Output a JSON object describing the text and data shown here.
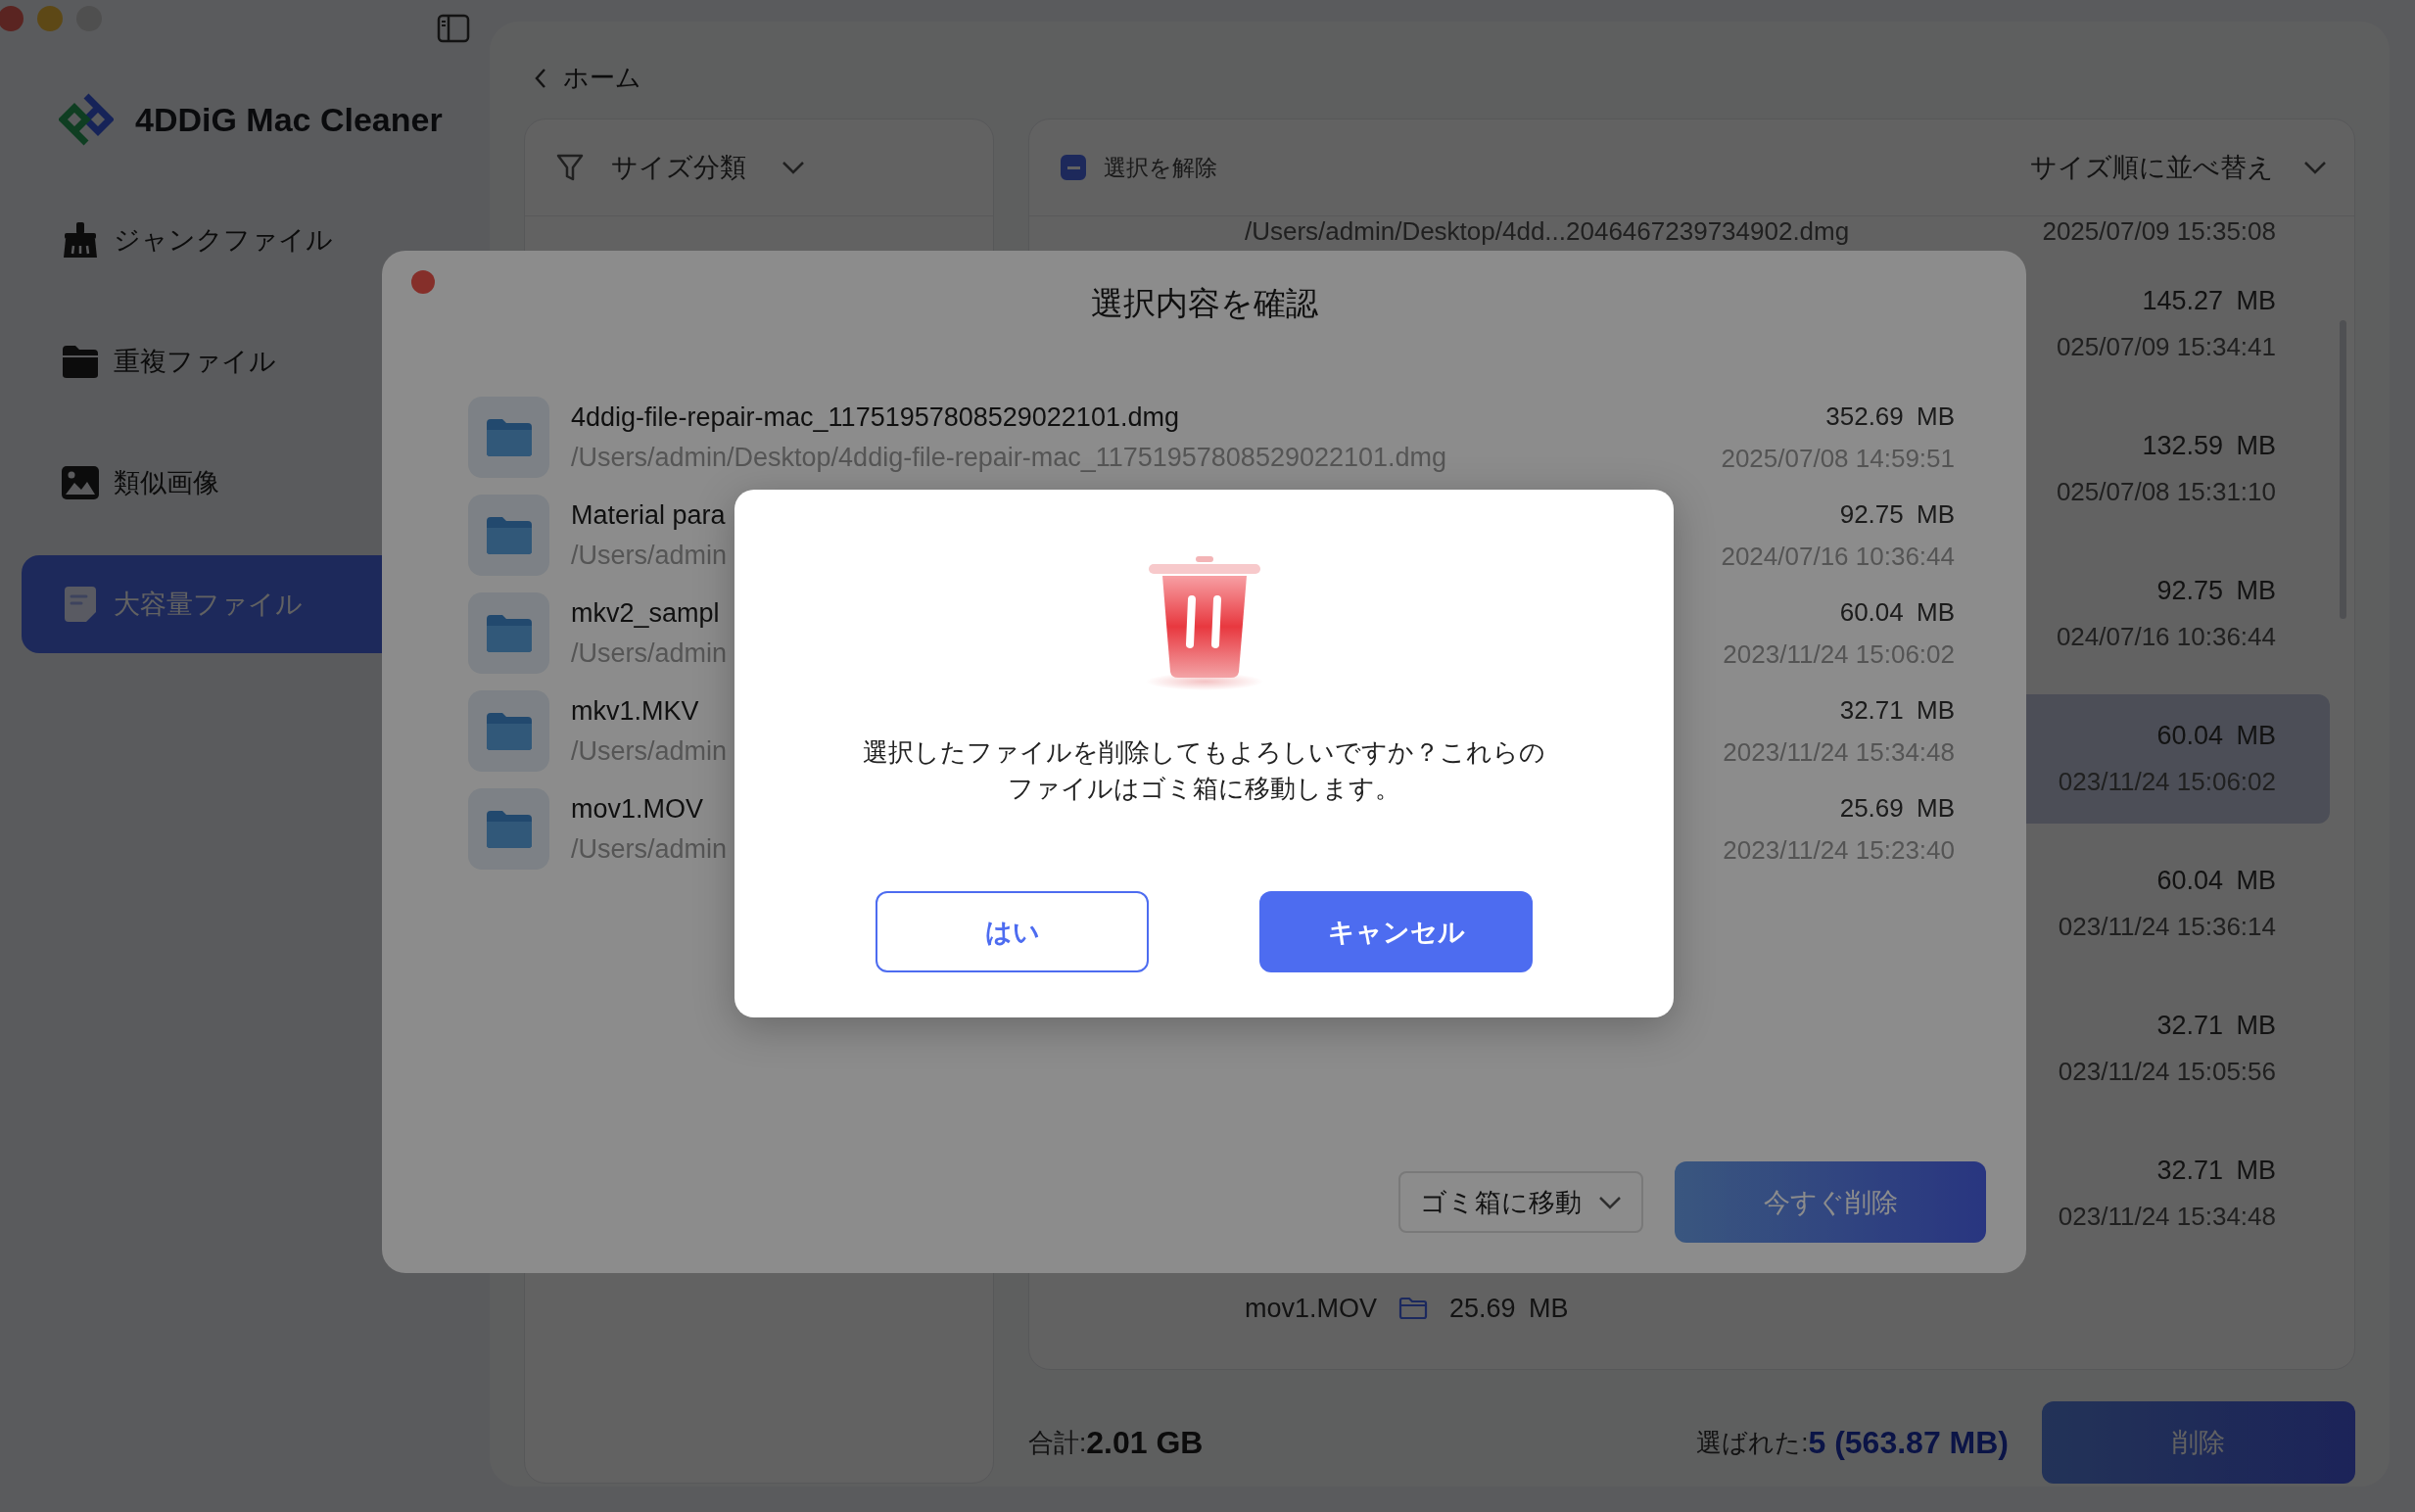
{
  "sidebar": {
    "app_name": "4DDiG Mac Cleaner",
    "items": [
      {
        "label": "ジャンクファイル",
        "kind": "junk",
        "selected": false
      },
      {
        "label": "重複ファイル",
        "kind": "duplicate",
        "selected": false
      },
      {
        "label": "類似画像",
        "kind": "image",
        "selected": false
      },
      {
        "label": "大容量ファイル",
        "kind": "large",
        "selected": true
      }
    ]
  },
  "back_link": "ホーム",
  "filter": {
    "label": "サイズ分類"
  },
  "list": {
    "indeterminate": true,
    "select_label": "選択を解除",
    "sort_label": "サイズ順に並べ替え",
    "rows": [
      {
        "kind": "path",
        "path": "/Users/admin/Desktop/4dd...2046467239734902.dmg",
        "date": "2025/07/09 15:35:08",
        "highlighted": false
      },
      {
        "kind": "stats",
        "size": "145.27 MB",
        "date": "025/07/09 15:34:41",
        "highlighted": false
      },
      {
        "kind": "stats",
        "size": "132.59 MB",
        "date": "025/07/08 15:31:10",
        "highlighted": false
      },
      {
        "kind": "stats",
        "size": "92.75 MB",
        "date": "024/07/16 10:36:44",
        "highlighted": false
      },
      {
        "kind": "stats",
        "size": "60.04 MB",
        "date": "023/11/24 15:06:02",
        "highlighted": true
      },
      {
        "kind": "stats",
        "size": "60.04 MB",
        "date": "023/11/24 15:36:14",
        "highlighted": false
      },
      {
        "kind": "stats",
        "size": "32.71 MB",
        "date": "023/11/24 15:05:56",
        "highlighted": false
      },
      {
        "kind": "stats",
        "size": "32.71 MB",
        "date": "023/11/24 15:34:48",
        "highlighted": false
      },
      {
        "kind": "name",
        "name": "mov1.MOV",
        "size": "25.69 MB",
        "highlighted": false
      }
    ]
  },
  "footer": {
    "total_label": "合計:",
    "total_value": "2.01 GB",
    "selected_label": "選ばれた:",
    "selected_value": "5 (563.87 MB)",
    "delete_button": "削除"
  },
  "confirm_modal": {
    "title": "選択内容を確認",
    "files": [
      {
        "name": "4ddig-file-repair-mac_11751957808529022101.dmg",
        "path": "/Users/admin/Desktop/4ddig-file-repair-mac_11751957808529022101.dmg",
        "size": "352.69 MB",
        "date": "2025/07/08 14:59:51"
      },
      {
        "name": "Material para",
        "path": "/Users/admin",
        "size": "92.75 MB",
        "date": "2024/07/16 10:36:44"
      },
      {
        "name": "mkv2_sampl",
        "path": "/Users/admin",
        "size": "60.04 MB",
        "date": "2023/11/24 15:06:02"
      },
      {
        "name": "mkv1.MKV",
        "path": "/Users/admin",
        "size": "32.71 MB",
        "date": "2023/11/24 15:34:48"
      },
      {
        "name": "mov1.MOV",
        "path": "/Users/admin",
        "size": "25.69 MB",
        "date": "2023/11/24 15:23:40"
      }
    ],
    "action_select": "ゴミ箱に移動",
    "delete_now_button": "今すぐ削除"
  },
  "alert": {
    "message": "選択したファイルを削除してもよろしいですか？これらのファイルはゴミ箱に移動します。",
    "yes_button": "はい",
    "cancel_button": "キャンセル"
  }
}
